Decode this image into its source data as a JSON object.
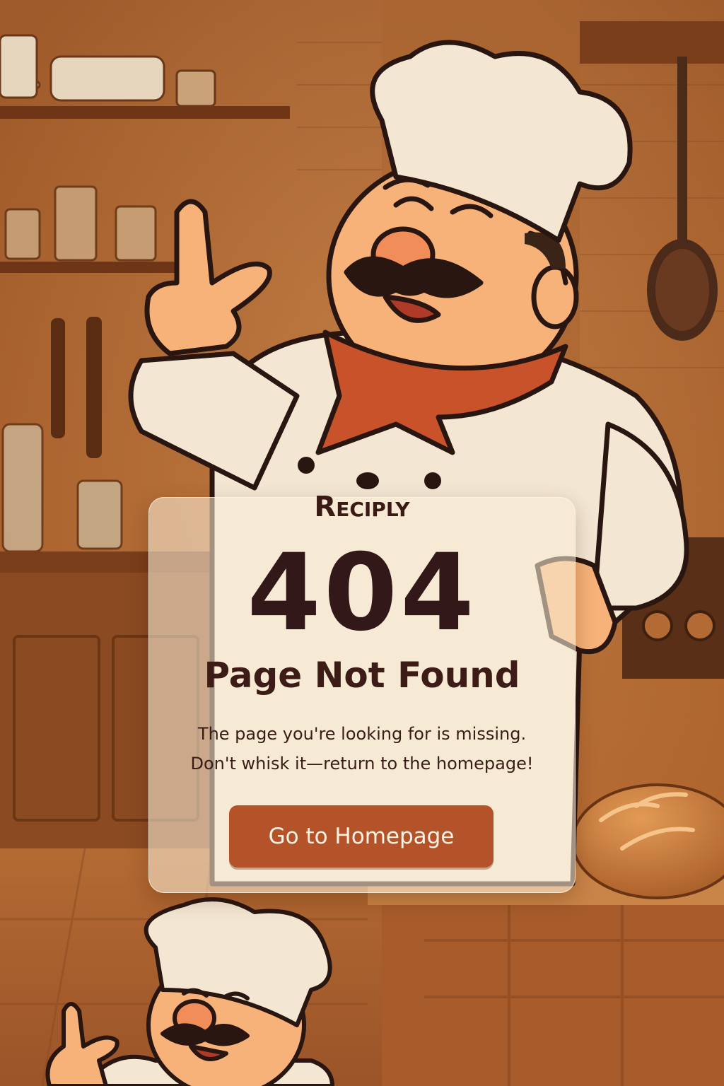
{
  "brand": {
    "name": "Reciply"
  },
  "error": {
    "code": "404",
    "title": "Page Not Found",
    "message_line1": "The page you're looking for is missing.",
    "message_line2": "Don't whisk it—return to the homepage!"
  },
  "actions": {
    "home_label": "Go to Homepage"
  },
  "colors": {
    "card_bg": "#faecd6",
    "text_dark": "#33181a",
    "button": "#b4532a",
    "button_text": "#fff4e4",
    "kitchen_bg": "#a8612e",
    "scarf": "#c8532a"
  },
  "illustration": {
    "subject": "chef-mascot",
    "icons": [
      "chef-hat-icon",
      "frying-pan-icon",
      "bread-loaf-icon"
    ]
  }
}
